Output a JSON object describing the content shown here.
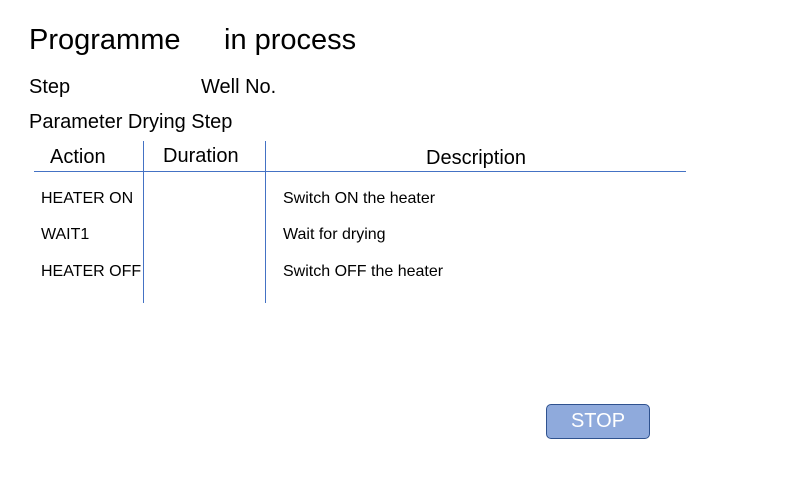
{
  "header": {
    "programme_label": "Programme",
    "status_label": "in process"
  },
  "info": {
    "step_label": "Step",
    "well_label": "Well No.",
    "parameter_label": "Parameter Drying Step"
  },
  "table": {
    "columns": [
      "Action",
      "Duration",
      "Description"
    ],
    "rows": [
      {
        "action": "HEATER ON",
        "duration": "",
        "description": "Switch ON the heater"
      },
      {
        "action": "WAIT1",
        "duration": "",
        "description": "Wait for drying"
      },
      {
        "action": "HEATER OFF",
        "duration": "",
        "description": "Switch OFF the heater"
      }
    ]
  },
  "controls": {
    "stop_label": "STOP"
  },
  "colors": {
    "table_lines": "#4472c4",
    "stop_button_fill": "#8faadc",
    "stop_button_border": "#2f528f"
  }
}
